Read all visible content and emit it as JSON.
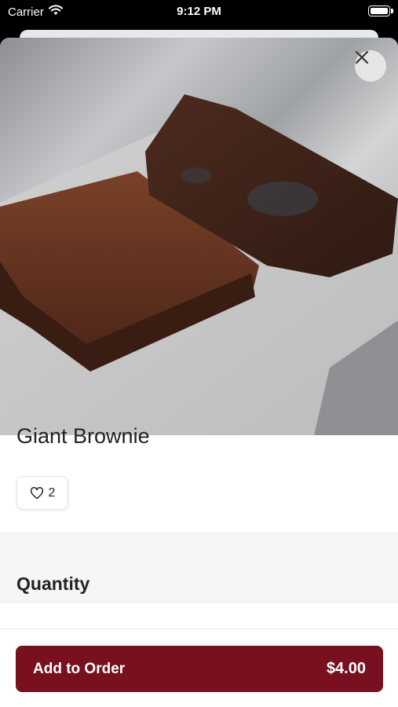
{
  "status_bar": {
    "carrier": "Carrier",
    "time": "9:12 PM"
  },
  "item": {
    "name": "Giant Brownie",
    "likes": "2"
  },
  "sections": {
    "quantity_heading": "Quantity"
  },
  "order_button": {
    "label": "Add to Order",
    "price": "$4.00"
  },
  "colors": {
    "brand": "#78101f"
  },
  "icons": {
    "close": "close-icon",
    "heart": "heart-icon",
    "wifi": "wifi-icon",
    "battery": "battery-icon"
  }
}
